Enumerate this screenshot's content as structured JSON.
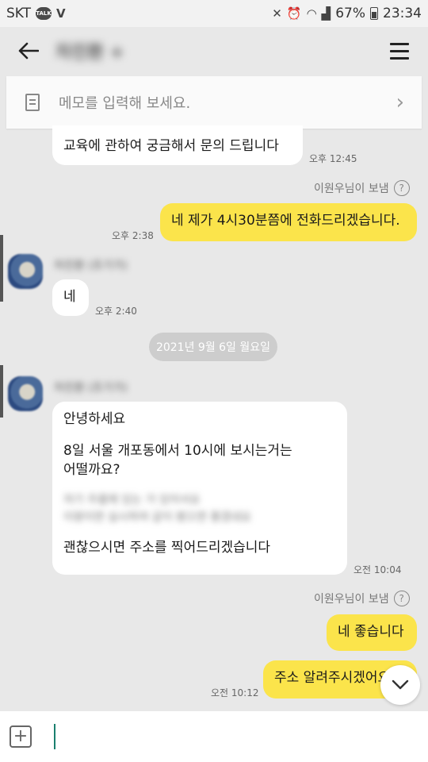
{
  "statusbar": {
    "carrier": "SKT",
    "talk_badge": "TALK",
    "battery_percent": "67%",
    "clock": "23:34"
  },
  "header": {
    "title": "차진환 +"
  },
  "memo": {
    "placeholder": "메모를 입력해 보세요."
  },
  "messages": {
    "m1_text": "교육에 관하여 궁금해서 문의 드립니다",
    "m1_time": "오후 12:45",
    "sender_note_1": "이원우님이 보냄",
    "m2_text": "네 제가 4시30분쯤에 전화드리겠습니다.",
    "m2_time": "오후 2:38",
    "sender_name_1": "차진환 (조기가)",
    "m3_text": "네",
    "m3_time": "오후 2:40",
    "date_divider": "2021년 9월 6일 월요일",
    "sender_name_2": "차진환 (조기가)",
    "m4_line1": "안녕하세요",
    "m4_line2": "8일 서울 개포동에서 10시에 보시는거는",
    "m4_line3": "어떨까요?",
    "m4_blur1": "저기 주름에 있는 거 있어서요",
    "m4_blur2": "이왕이면 실시하여 같이 봤으면 좋겠네요",
    "m4_line4": "괜찮으시면 주소를 찍어드리겠습니다",
    "m4_time": "오전 10:04",
    "sender_note_2": "이원우님이 보냄",
    "m5_text": "네 좋습니다",
    "m6_text": "주소 알려주시겠어요",
    "m6_time": "오전 10:12"
  },
  "icons": {
    "back": "arrow-left",
    "menu": "hamburger",
    "memo": "document",
    "scroll_down": "chevron-down",
    "attach": "plus-square"
  },
  "colors": {
    "outgoing_bubble": "#fbe44b",
    "incoming_bubble": "#ffffff",
    "background": "#e8e8e8",
    "cursor": "#1a7f6e"
  }
}
